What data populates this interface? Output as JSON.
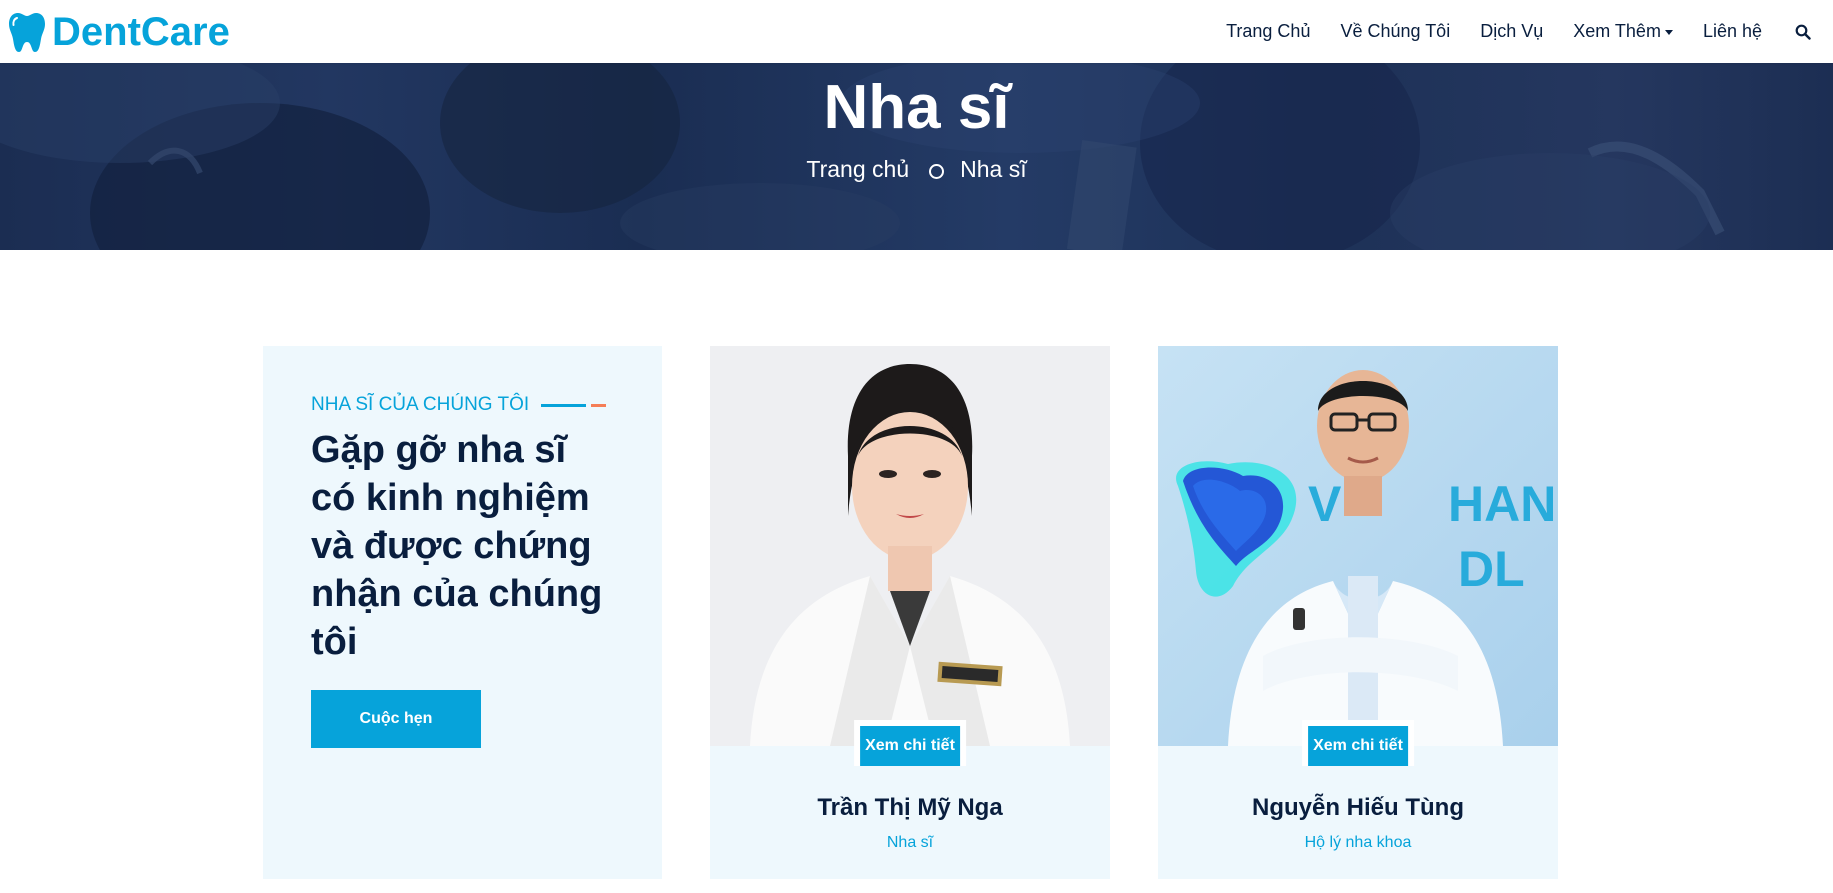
{
  "brand": {
    "name": "DentCare",
    "icon": "tooth-icon",
    "color": "#06a3da"
  },
  "nav": {
    "items": [
      "Trang Chủ",
      "Về Chúng Tôi",
      "Dịch Vụ",
      "Xem Thêm",
      "Liên hệ"
    ],
    "dropdown_icon": "caret-down-icon",
    "search_icon": "search-icon"
  },
  "hero": {
    "title": "Nha sĩ",
    "breadcrumb": [
      "Trang chủ",
      "Nha sĩ"
    ],
    "separator_icon": "circle-icon"
  },
  "team": {
    "label": "NHA SĨ CỦA CHÚNG TÔI",
    "heading": "Gặp gỡ nha sĩ có kinh nghiệm và được chứng nhận của chúng tôi",
    "button": "Cuộc hẹn",
    "members": [
      {
        "name": "Trần Thị Mỹ Nga",
        "role": "Nha sĩ",
        "button": "Xem chi tiết"
      },
      {
        "name": "Nguyễn Hiếu Tùng",
        "role": "Hộ lý nha khoa",
        "button": "Xem chi tiết"
      }
    ]
  },
  "colors": {
    "primary": "#06a3da",
    "dark": "#091e3e",
    "light_bg": "#eef8fd",
    "accent": "#f57e57"
  }
}
